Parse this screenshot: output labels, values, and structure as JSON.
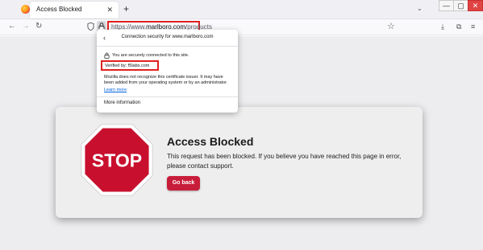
{
  "browser": {
    "tab": {
      "title": "Access Blocked",
      "close_glyph": "✕"
    },
    "new_tab_glyph": "+",
    "tab_list_glyph": "⌄",
    "window_controls": {
      "minimize": "—",
      "maximize": "▢",
      "close": "✕"
    },
    "nav": {
      "back": "←",
      "forward": "→",
      "reload": "↻",
      "bookmark": "☆"
    },
    "url": {
      "prefix": "https://www.",
      "host": "marlboro.com",
      "path": "/products"
    },
    "toolbar": {
      "downloads": "⤓",
      "extensions": "⧉",
      "menu": "≡"
    }
  },
  "popup": {
    "back_glyph": "‹",
    "title": "Connection security for www.marlboro.com",
    "connected": "You are securely connected to this site.",
    "verified_by": "Verified by: f5labs.com",
    "note": "Mozilla does not recognize this certificate issuer. It may have been added from your operating system or by an administrator.",
    "learn_more": "Learn more",
    "more_information": "More information"
  },
  "page": {
    "stop_sign_text": "STOP",
    "heading": "Access Blocked",
    "message": "This request has been blocked. If you believe you have reached this page in error, please contact support.",
    "go_back": "Go back"
  },
  "colors": {
    "stop_red": "#c8102e",
    "button_red": "#c81d3a",
    "highlight_red": "#e02020",
    "link_blue": "#0060df"
  },
  "icons": [
    "firefox-logo-icon",
    "close-icon",
    "plus-icon",
    "chevron-down-icon",
    "back-arrow-icon",
    "forward-arrow-icon",
    "reload-icon",
    "shield-icon",
    "lock-icon",
    "star-icon",
    "download-icon",
    "extensions-icon",
    "menu-icon"
  ]
}
